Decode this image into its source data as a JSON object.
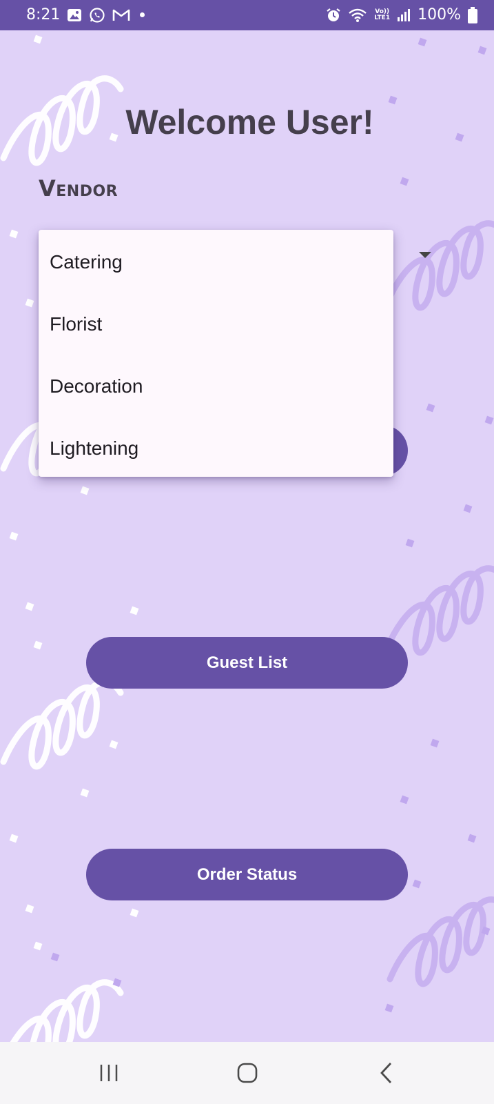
{
  "status_bar": {
    "time": "8:21",
    "battery": "100%",
    "network": "LTE1",
    "network_label": "Vo))",
    "icons": [
      "gallery-icon",
      "whatsapp-icon",
      "gmail-icon",
      "alarm-icon",
      "wifi-icon",
      "signal-icon",
      "battery-icon"
    ]
  },
  "header": {
    "title": "Welcome User!"
  },
  "vendor": {
    "label": "Vendor",
    "options": [
      "Catering",
      "Florist",
      "Decoration",
      "Lightening"
    ]
  },
  "buttons": {
    "guest_list": "Guest List",
    "order_status": "Order Status"
  },
  "nav": {
    "items": [
      "recents-icon",
      "home-icon",
      "back-icon"
    ]
  },
  "colors": {
    "primary": "#6651a6",
    "background": "#e0d2f8",
    "menu": "#fef8fd"
  }
}
